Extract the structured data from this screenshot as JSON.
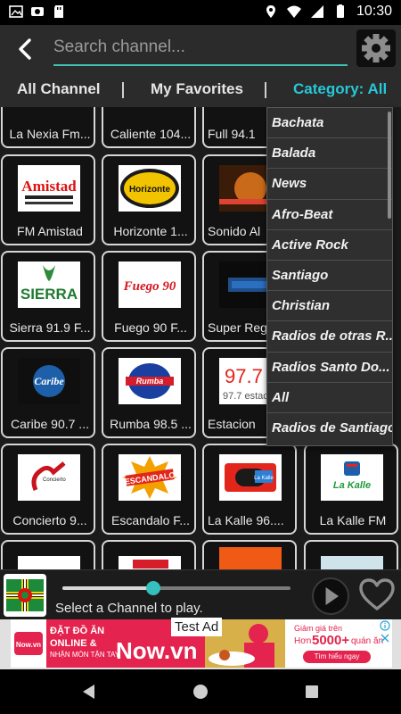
{
  "status": {
    "time": "10:30"
  },
  "search": {
    "placeholder": "Search channel..."
  },
  "tabs": [
    {
      "label": "All Channel"
    },
    {
      "label": "My Favorites"
    },
    {
      "label": "Category: All"
    }
  ],
  "stations": [
    {
      "name": "La Nexia Fm...",
      "logo": ""
    },
    {
      "name": "Caliente 104...",
      "logo": ""
    },
    {
      "name": "Full 94.1",
      "logo": ""
    },
    {
      "name": "FM Amistad",
      "logo": "Amistad"
    },
    {
      "name": "Horizonte 1...",
      "logo": "Horizonte"
    },
    {
      "name": "Sonido Al",
      "logo": ""
    },
    {
      "name": "Sierra 91.9 F...",
      "logo": "SIERRA"
    },
    {
      "name": "Fuego 90 F...",
      "logo": "Fuego 90"
    },
    {
      "name": "Super Reg",
      "logo": ""
    },
    {
      "name": "Caribe 90.7 ...",
      "logo": "Caribe"
    },
    {
      "name": "Rumba 98.5 ...",
      "logo": "Rumba"
    },
    {
      "name": "Estacion",
      "logo": "97.7 estacion"
    },
    {
      "name": "Concierto 9...",
      "logo": "Concierto"
    },
    {
      "name": "Escandalo F...",
      "logo": "ESCANDALO"
    },
    {
      "name": "La Kalle 96....",
      "logo": "La Kalle"
    },
    {
      "name": "La Kalle FM",
      "logo": "La Kalle"
    }
  ],
  "categories": [
    "Bachata",
    "Balada",
    "News",
    "Afro-Beat",
    "Active Rock",
    "Santiago",
    "Christian",
    "Radios de otras R...",
    "Radios Santo Do...",
    "All",
    "Radios de Santiago"
  ],
  "player": {
    "status_text": "Select a Channel to play.",
    "progress": 0.4
  },
  "ad": {
    "tag": "Test Ad",
    "lines": [
      "ĐẶT ĐỒ ĂN",
      "ONLINE &",
      "NHẬN MÓN TẬN TAY"
    ],
    "brand": "Now.vn",
    "promo_1": "Giảm giá trên",
    "promo_2": "Hơn",
    "promo_count": "5000+",
    "promo_3": "quán ăn",
    "cta": "Tìm hiểu ngay",
    "small_logo": "Now.vn"
  },
  "colors": {
    "accent": "#27c8d8",
    "slider_thumb": "#35c0bd",
    "ad_red": "#e4234f"
  }
}
